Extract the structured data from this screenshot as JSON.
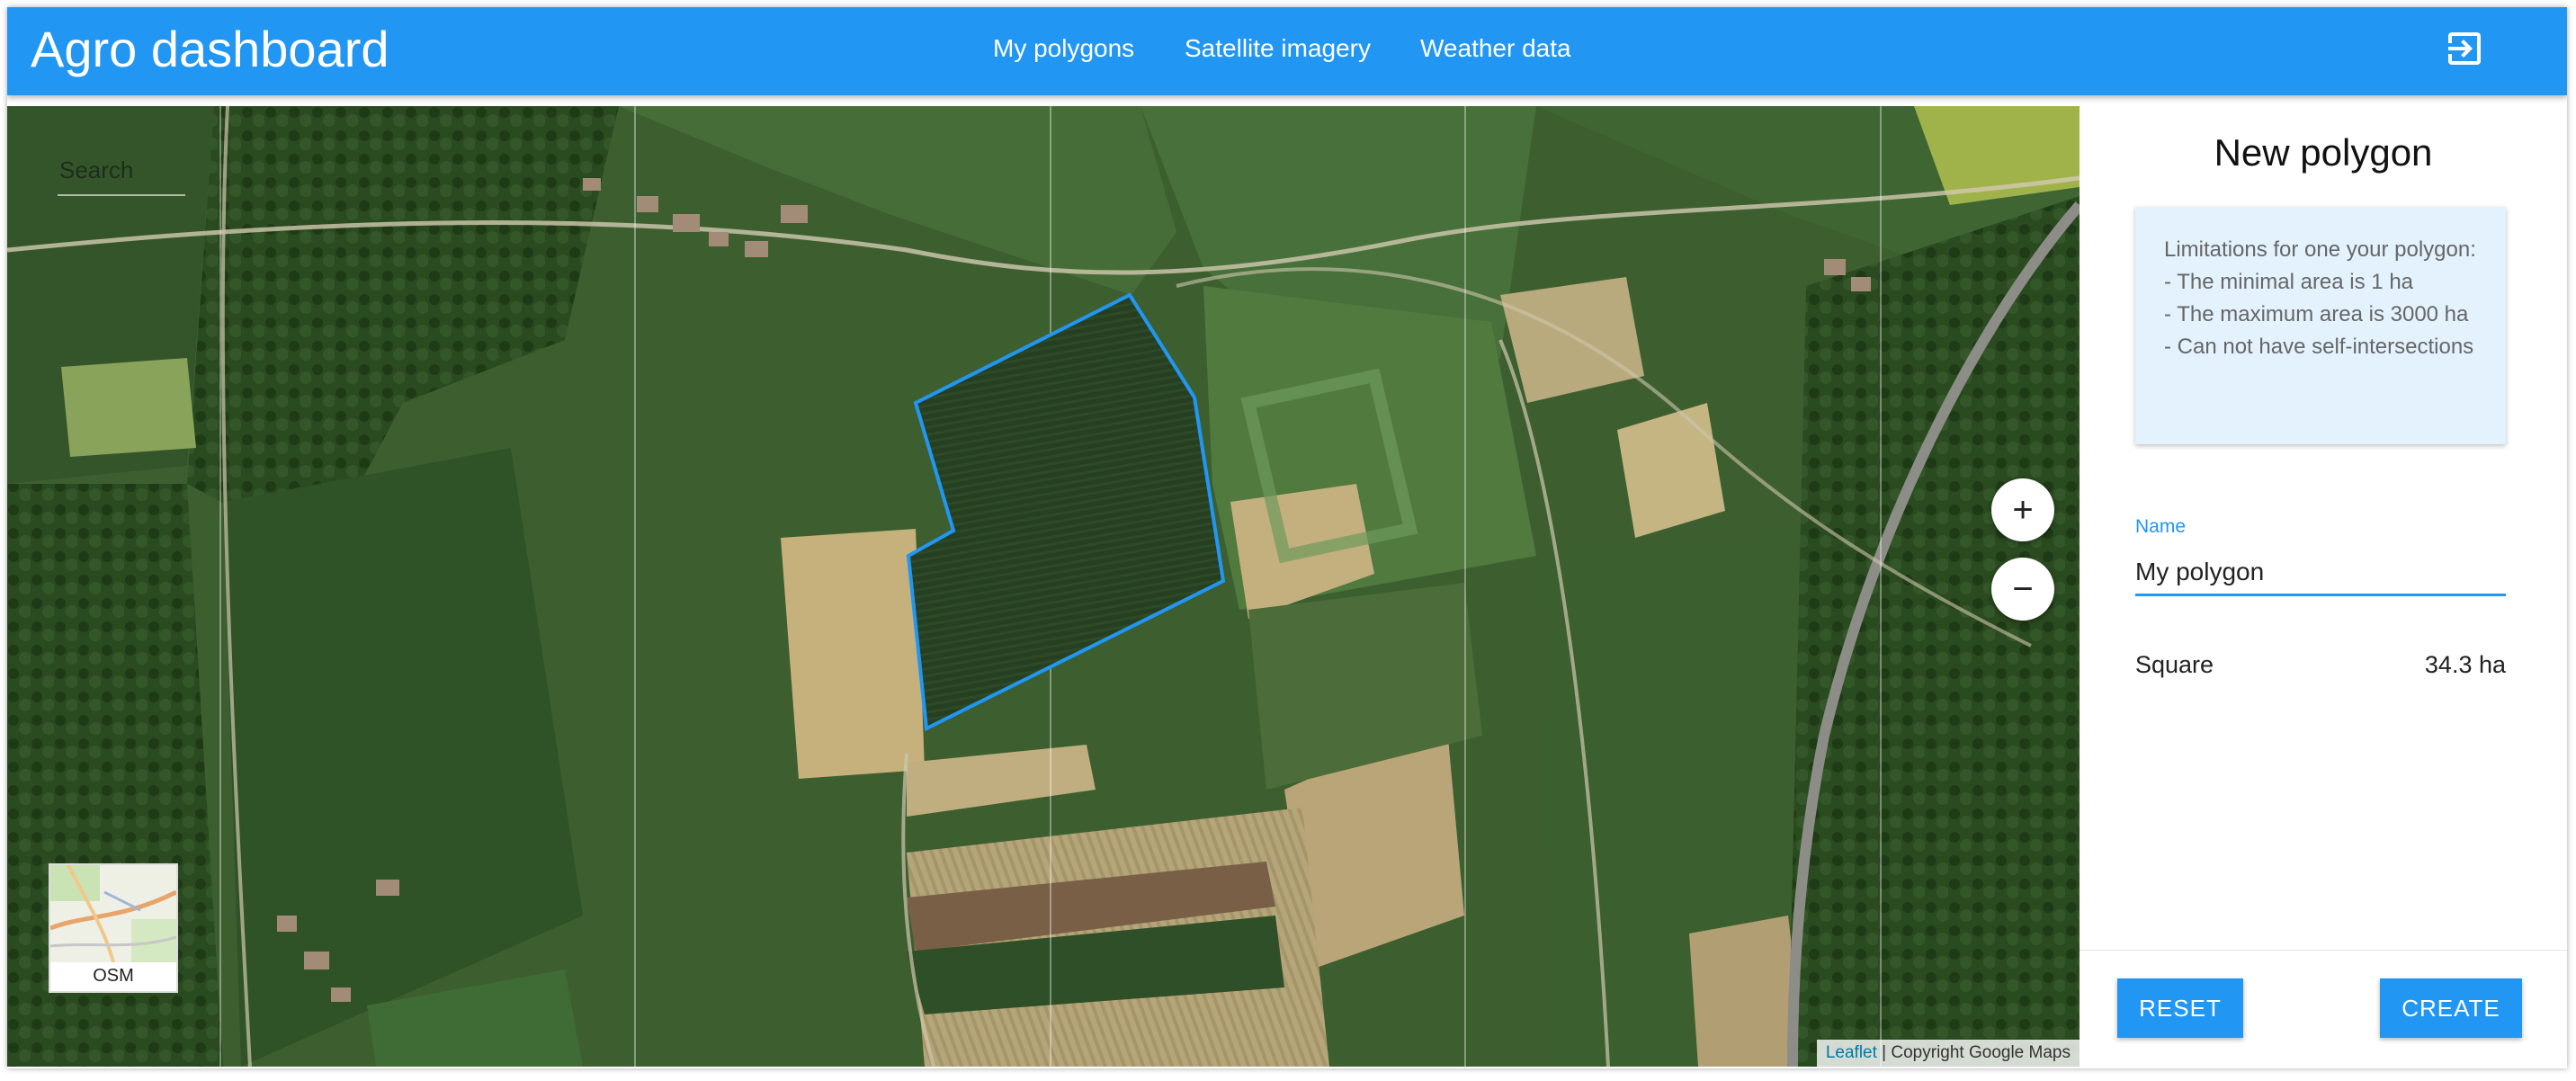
{
  "header": {
    "title": "Agro dashboard",
    "nav": [
      "My polygons",
      "Satellite imagery",
      "Weather data"
    ],
    "logout_icon": "logout-icon"
  },
  "map": {
    "search_placeholder": "Search",
    "zoom_in_label": "+",
    "zoom_out_label": "−",
    "layer_label": "OSM",
    "attribution_link": "Leaflet",
    "attribution_text": " | Copyright Google Maps",
    "polygon_color": "#2196f3"
  },
  "panel": {
    "title": "New polygon",
    "limitations": "Limitations for one your polygon:\n- The minimal area is 1 ha\n- The maximum area is 3000 ha\n- Can not have self-intersections",
    "name_label": "Name",
    "name_value": "My polygon",
    "square_label": "Square",
    "square_value": "34.3 ha",
    "reset_label": "RESET",
    "create_label": "CREATE"
  },
  "colors": {
    "accent": "#2196f3",
    "info_bg": "#e3f2fd"
  }
}
